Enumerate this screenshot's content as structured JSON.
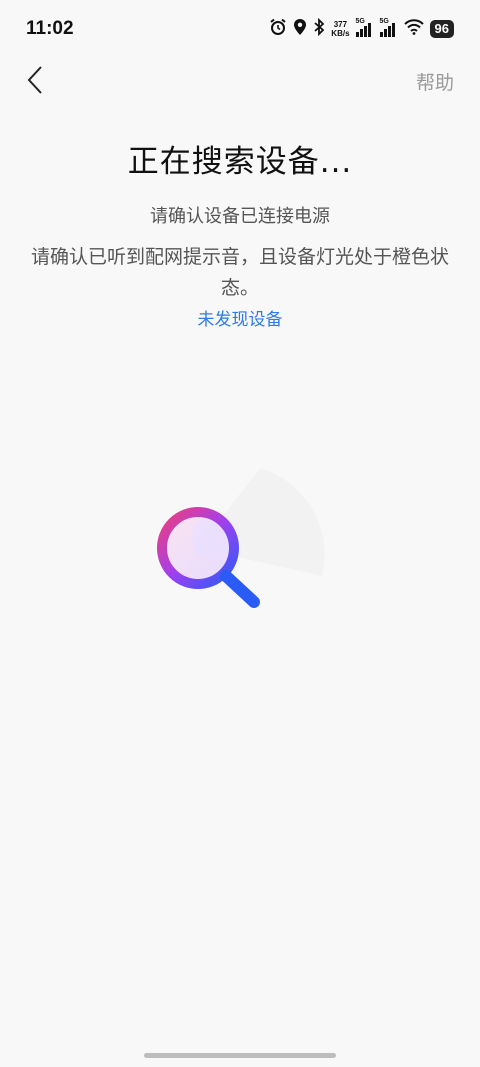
{
  "status_bar": {
    "time": "11:02",
    "net_speed_value": "377",
    "net_speed_unit": "KB/s",
    "sim1_label": "5G",
    "sim2_label": "5G",
    "battery": "96",
    "icons": [
      "alarm-icon",
      "location-icon",
      "bluetooth-icon",
      "signal-icon",
      "wifi-icon",
      "battery-icon"
    ]
  },
  "nav": {
    "back_icon": "chevron-left-icon",
    "help_label": "帮助"
  },
  "main": {
    "title": "正在搜索设备...",
    "subtitle": "请确认设备已连接电源",
    "description": "请确认已听到配网提示音，且设备灯光处于橙色状态。",
    "not_found_link": "未发现设备"
  },
  "colors": {
    "accent_link": "#2f7ae5",
    "magnifier_gradient": [
      "#ef3f7b",
      "#8a3cf2",
      "#2a5cf5"
    ],
    "background": "#f8f8f8"
  }
}
